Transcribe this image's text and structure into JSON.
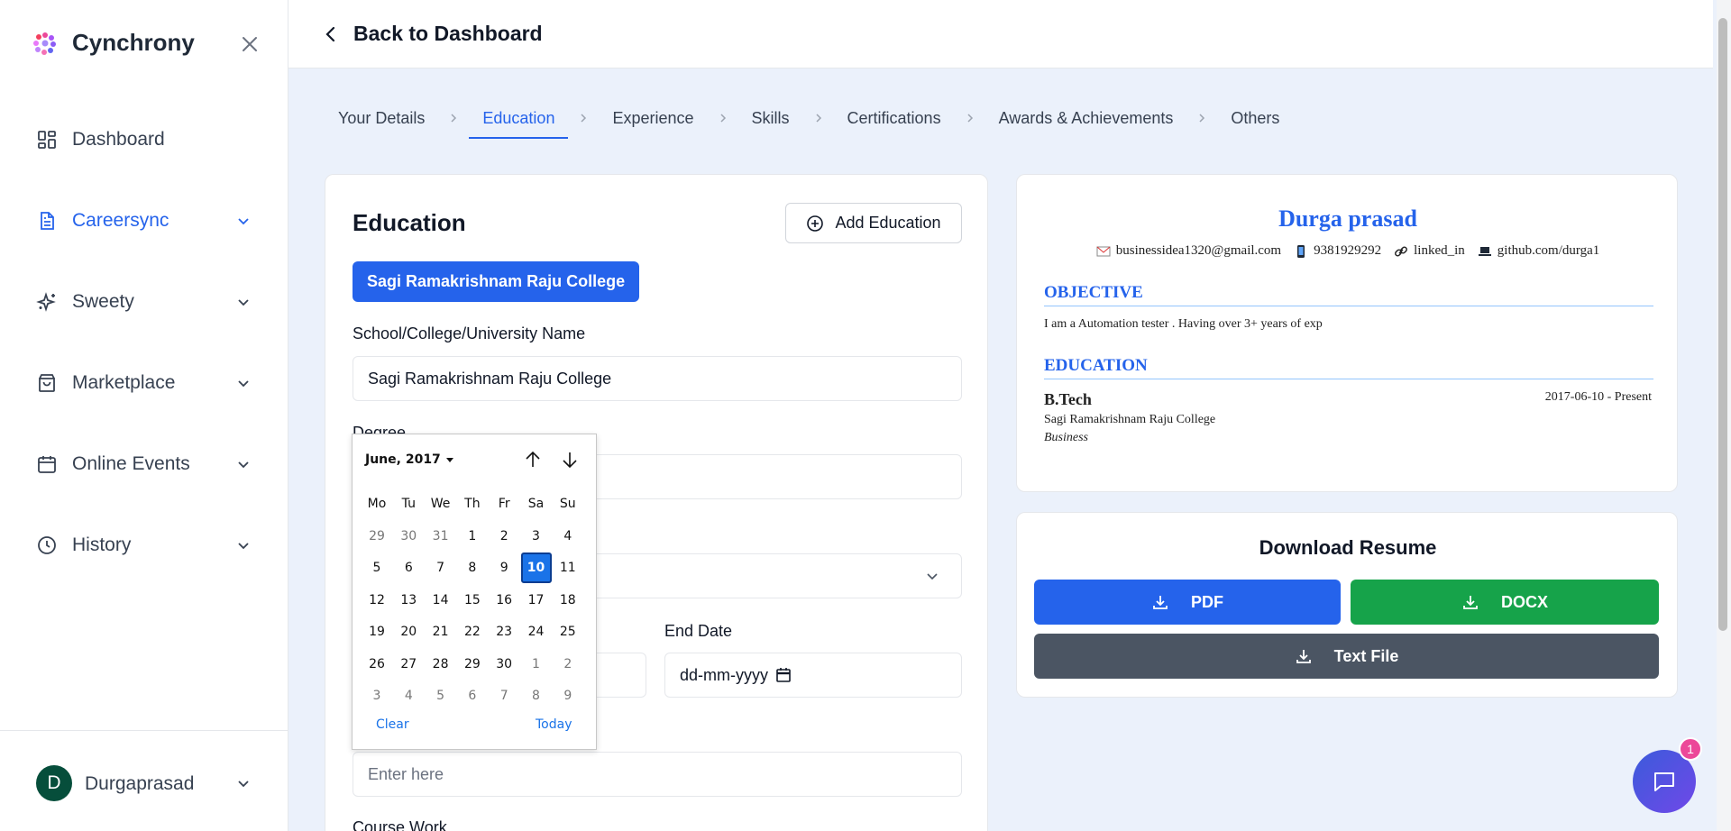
{
  "app": {
    "name": "Cynchrony"
  },
  "sidebar": {
    "items": [
      {
        "label": "Dashboard",
        "icon": "dashboard-icon",
        "active": false,
        "expandable": false
      },
      {
        "label": "Careersync",
        "icon": "document-icon",
        "active": true,
        "expandable": true
      },
      {
        "label": "Sweety",
        "icon": "sparkles-icon",
        "active": false,
        "expandable": true
      },
      {
        "label": "Marketplace",
        "icon": "shopping-bag-icon",
        "active": false,
        "expandable": true
      },
      {
        "label": "Online Events",
        "icon": "calendar-icon",
        "active": false,
        "expandable": true
      },
      {
        "label": "History",
        "icon": "clock-icon",
        "active": false,
        "expandable": true
      }
    ],
    "user": {
      "initial": "D",
      "name": "Durgaprasad"
    }
  },
  "topbar": {
    "back_label": "Back to Dashboard"
  },
  "steps": [
    "Your Details",
    "Education",
    "Experience",
    "Skills",
    "Certifications",
    "Awards & Achievements",
    "Others"
  ],
  "active_step": "Education",
  "form": {
    "title": "Education",
    "add_button": "Add Education",
    "college_pill": "Sagi Ramakrishnam Raju College",
    "school_label": "School/College/University Name",
    "school_value": "Sagi Ramakrishnam Raju College",
    "degree_label": "Degree",
    "end_date_label": "End Date",
    "end_date_placeholder": "dd-mm-yyyy",
    "enter_here_placeholder": "Enter here",
    "course_work_label": "Course Work"
  },
  "datepicker": {
    "month_label": "June, 2017",
    "weekdays": [
      "Mo",
      "Tu",
      "We",
      "Th",
      "Fr",
      "Sa",
      "Su"
    ],
    "weeks": [
      [
        "29",
        "30",
        "31",
        "1",
        "2",
        "3",
        "4"
      ],
      [
        "5",
        "6",
        "7",
        "8",
        "9",
        "10",
        "11"
      ],
      [
        "12",
        "13",
        "14",
        "15",
        "16",
        "17",
        "18"
      ],
      [
        "19",
        "20",
        "21",
        "22",
        "23",
        "24",
        "25"
      ],
      [
        "26",
        "27",
        "28",
        "29",
        "30",
        "1",
        "2"
      ],
      [
        "3",
        "4",
        "5",
        "6",
        "7",
        "8",
        "9"
      ]
    ],
    "selected_day": "10",
    "clear_label": "Clear",
    "today_label": "Today"
  },
  "resume": {
    "name": "Durga prasad",
    "email": "businessidea1320@gmail.com",
    "phone": "9381929292",
    "linkedin": "linked_in",
    "github": "github.com/durga1",
    "objective_heading": "OBJECTIVE",
    "objective_text": "I am a Automation tester . Having over 3+ years of exp",
    "education_heading": "EDUCATION",
    "degree": "B.Tech",
    "dates": "2017-06-10 - Present",
    "college": "Sagi Ramakrishnam Raju College",
    "field": "Business"
  },
  "download": {
    "title": "Download Resume",
    "pdf_label": "PDF",
    "docx_label": "DOCX",
    "text_label": "Text File"
  },
  "chat": {
    "badge_count": "1"
  },
  "colors": {
    "primary": "#2563eb",
    "success": "#16a34a",
    "dark": "#4b5563",
    "selected_day": "#1a73e8"
  }
}
